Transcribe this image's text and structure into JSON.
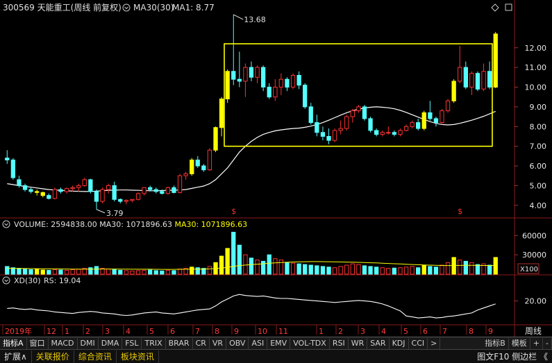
{
  "header": {
    "code": "300569",
    "name": "天能重工",
    "period": "(周线 前复权)",
    "ma_label": "MA30(30)",
    "ma_value": "MA1: 8.77"
  },
  "annotations": {
    "high": "13.68",
    "low": "3.79"
  },
  "volume_header": {
    "title": "VOLUME: 2594838.00",
    "ma_white": "MA30: 1071896.63",
    "ma_yellow": "MA30: 1071896.63",
    "unit": "X100"
  },
  "xd_header": {
    "title": "XD(30)",
    "rs": "RS: 19.04"
  },
  "period_label": "周线",
  "x_axis_labels": [
    "2019年",
    "12",
    "1",
    "2",
    "3",
    "4",
    "5",
    "6",
    "7",
    "8",
    "9",
    "10",
    "11",
    "1",
    "2",
    "3",
    "4",
    "5",
    "6",
    "7",
    "8",
    "9"
  ],
  "indicator_tabs": [
    "指标A",
    "窗口",
    "MACD",
    "DMI",
    "DMA",
    "FSL",
    "TRIX",
    "BRAR",
    "CR",
    "VR",
    "OBV",
    "ASI",
    "EMV",
    "VOL-TDX",
    "RSI",
    "WR",
    "SAR",
    "KDJ",
    "CCI",
    ">"
  ],
  "right_tabs": [
    "指标B",
    "模板",
    "+",
    "-"
  ],
  "bottom_bar": {
    "left": [
      "扩展∧",
      "关联报价",
      "综合资讯",
      "板块资讯"
    ],
    "right": "图文F10 侧边栏 《"
  },
  "markers": [
    "$",
    "$"
  ],
  "chart_data": [
    {
      "type": "candlestick",
      "title": "300569 天能重工 (周线 前复权)",
      "ylim": [
        3.5,
        14.0
      ],
      "y_ticks": [
        4.0,
        5.0,
        6.0,
        7.0,
        8.0,
        9.0,
        10.0,
        11.0,
        12.0
      ],
      "colors": {
        "up": "#ff3232",
        "down": "#54ffff",
        "ma": "#ffffff",
        "highlight": "#ffff00",
        "box": "#ffff00"
      },
      "ohlc": [
        [
          6.4,
          6.8,
          6.1,
          6.3
        ],
        [
          6.3,
          6.4,
          5.3,
          5.4
        ],
        [
          5.3,
          5.5,
          4.9,
          5.0
        ],
        [
          5.0,
          5.1,
          4.7,
          4.8
        ],
        [
          4.8,
          4.9,
          4.6,
          4.7
        ],
        [
          4.7,
          4.8,
          4.5,
          4.65
        ],
        [
          4.65,
          4.7,
          4.4,
          4.5
        ],
        [
          4.5,
          4.6,
          4.3,
          4.35
        ],
        [
          4.35,
          4.9,
          4.3,
          4.8
        ],
        [
          4.8,
          4.9,
          4.6,
          4.7
        ],
        [
          4.7,
          4.9,
          4.6,
          4.85
        ],
        [
          4.85,
          5.0,
          4.7,
          4.9
        ],
        [
          4.9,
          5.1,
          4.7,
          5.0
        ],
        [
          5.0,
          5.4,
          4.95,
          5.3
        ],
        [
          5.3,
          5.35,
          4.6,
          4.7
        ],
        [
          4.7,
          4.8,
          3.79,
          4.2
        ],
        [
          4.2,
          4.9,
          4.1,
          4.8
        ],
        [
          4.8,
          5.1,
          4.6,
          5.0
        ],
        [
          5.0,
          5.2,
          4.2,
          4.3
        ],
        [
          4.3,
          4.35,
          4.1,
          4.2
        ],
        [
          4.2,
          4.3,
          4.05,
          4.25
        ],
        [
          4.25,
          4.3,
          4.15,
          4.3
        ],
        [
          4.3,
          4.65,
          4.25,
          4.6
        ],
        [
          4.6,
          4.9,
          4.5,
          4.9
        ],
        [
          4.9,
          5.0,
          4.7,
          4.8
        ],
        [
          4.8,
          4.9,
          4.6,
          4.7
        ],
        [
          4.7,
          4.8,
          4.55,
          4.6
        ],
        [
          4.6,
          4.95,
          4.55,
          4.9
        ],
        [
          4.9,
          5.0,
          4.6,
          4.65
        ],
        [
          4.65,
          5.6,
          4.6,
          5.5
        ],
        [
          5.5,
          5.7,
          5.3,
          5.6
        ],
        [
          5.6,
          6.4,
          5.5,
          6.3
        ],
        [
          6.3,
          6.5,
          5.9,
          6.0
        ],
        [
          6.0,
          6.1,
          5.7,
          5.8
        ],
        [
          5.8,
          6.9,
          5.75,
          6.8
        ],
        [
          6.8,
          8.0,
          6.7,
          7.95
        ],
        [
          7.95,
          9.5,
          7.5,
          9.4
        ],
        [
          9.4,
          10.9,
          9.2,
          10.8
        ],
        [
          10.8,
          13.68,
          10.1,
          10.4
        ],
        [
          10.4,
          11.8,
          10.0,
          10.3
        ],
        [
          10.3,
          11.2,
          9.5,
          11.0
        ],
        [
          11.0,
          11.3,
          10.3,
          10.5
        ],
        [
          10.5,
          11.1,
          10.2,
          11.0
        ],
        [
          11.0,
          11.1,
          9.8,
          10.0
        ],
        [
          10.0,
          10.2,
          9.4,
          9.5
        ],
        [
          9.5,
          10.4,
          9.3,
          10.0
        ],
        [
          10.0,
          10.7,
          9.6,
          10.4
        ],
        [
          10.4,
          10.5,
          9.8,
          10.0
        ],
        [
          10.0,
          10.7,
          9.9,
          10.6
        ],
        [
          10.6,
          10.8,
          9.9,
          10.1
        ],
        [
          10.1,
          10.2,
          8.9,
          9.0
        ],
        [
          9.0,
          9.2,
          8.1,
          8.2
        ],
        [
          8.2,
          8.6,
          7.5,
          7.7
        ],
        [
          7.7,
          8.0,
          7.3,
          7.5
        ],
        [
          7.5,
          7.9,
          7.1,
          7.3
        ],
        [
          7.3,
          7.9,
          7.2,
          7.8
        ],
        [
          7.8,
          8.3,
          7.6,
          7.9
        ],
        [
          7.9,
          8.6,
          7.8,
          8.5
        ],
        [
          8.5,
          8.9,
          8.2,
          8.8
        ],
        [
          8.8,
          9.1,
          8.7,
          9.0
        ],
        [
          9.0,
          9.1,
          8.3,
          8.4
        ],
        [
          8.4,
          8.5,
          7.7,
          7.8
        ],
        [
          7.8,
          7.9,
          7.5,
          7.6
        ],
        [
          7.6,
          7.8,
          7.5,
          7.7
        ],
        [
          7.7,
          8.0,
          7.6,
          7.7
        ],
        [
          7.7,
          7.8,
          7.5,
          7.6
        ],
        [
          7.6,
          7.9,
          7.5,
          7.8
        ],
        [
          7.8,
          8.1,
          7.75,
          8.0
        ],
        [
          8.0,
          8.3,
          7.9,
          8.2
        ],
        [
          8.2,
          8.4,
          7.8,
          7.9
        ],
        [
          7.9,
          8.8,
          7.8,
          8.7
        ],
        [
          8.7,
          9.3,
          8.3,
          8.4
        ],
        [
          8.4,
          8.5,
          8.0,
          8.2
        ],
        [
          8.2,
          8.9,
          8.1,
          8.8
        ],
        [
          8.8,
          9.4,
          8.7,
          9.3
        ],
        [
          9.3,
          10.4,
          9.2,
          10.3
        ],
        [
          10.3,
          12.1,
          10.2,
          11.0
        ],
        [
          11.0,
          11.3,
          9.9,
          10.0
        ],
        [
          10.0,
          10.8,
          9.6,
          10.7
        ],
        [
          10.7,
          10.8,
          9.8,
          9.9
        ],
        [
          9.9,
          11.2,
          9.8,
          10.8
        ],
        [
          10.8,
          11.3,
          9.9,
          10.0
        ],
        [
          10.0,
          12.8,
          9.95,
          12.7
        ]
      ],
      "ma30": [
        5.1,
        5.05,
        5.0,
        4.96,
        4.92,
        4.88,
        4.84,
        4.8,
        4.78,
        4.76,
        4.74,
        4.72,
        4.71,
        4.7,
        4.7,
        4.72,
        4.74,
        4.76,
        4.77,
        4.78,
        4.78,
        4.77,
        4.76,
        4.75,
        4.74,
        4.74,
        4.75,
        4.76,
        4.77,
        4.78,
        4.8,
        4.86,
        4.92,
        4.98,
        5.1,
        5.3,
        5.6,
        5.9,
        6.3,
        6.7,
        7.0,
        7.25,
        7.45,
        7.6,
        7.7,
        7.78,
        7.83,
        7.87,
        7.9,
        7.92,
        7.96,
        8.02,
        8.1,
        8.2,
        8.32,
        8.45,
        8.58,
        8.7,
        8.8,
        8.88,
        8.94,
        8.98,
        9.0,
        8.98,
        8.95,
        8.9,
        8.82,
        8.72,
        8.6,
        8.48,
        8.36,
        8.25,
        8.16,
        8.1,
        8.08,
        8.1,
        8.16,
        8.24,
        8.32,
        8.42,
        8.52,
        8.64,
        8.77
      ],
      "highlight_bars": [
        5,
        6,
        31,
        35,
        36,
        37,
        70,
        75,
        82
      ],
      "box": {
        "x1_index": 37,
        "x2_index": 82,
        "y_top": 12.2,
        "y_bottom": 7.0
      }
    },
    {
      "type": "bar",
      "title": "VOLUME",
      "ylim": [
        0,
        70000
      ],
      "y_ticks": [
        30000,
        60000
      ],
      "volumes": [
        12000,
        10000,
        9000,
        8000,
        7000,
        7500,
        6500,
        6000,
        7000,
        6500,
        6000,
        7000,
        7500,
        9000,
        10000,
        12000,
        9000,
        8000,
        7500,
        6000,
        5500,
        5000,
        5500,
        6000,
        6500,
        5500,
        5000,
        6000,
        5500,
        8000,
        9000,
        11000,
        10000,
        9000,
        12000,
        18000,
        28000,
        40000,
        65000,
        45000,
        30000,
        25000,
        22000,
        20000,
        30000,
        24000,
        22000,
        18000,
        17000,
        16000,
        15000,
        14000,
        13000,
        12000,
        11000,
        10000,
        12000,
        14000,
        16000,
        15000,
        13000,
        12000,
        11000,
        10000,
        9000,
        9500,
        10000,
        11000,
        12000,
        10000,
        14000,
        12000,
        11000,
        14000,
        18000,
        26000,
        22000,
        20000,
        18000,
        15000,
        16000,
        14000,
        25948
      ],
      "ma30_line": [
        9000,
        8900,
        8800,
        8700,
        8600,
        8500,
        8400,
        8300,
        8200,
        8100,
        8000,
        7900,
        7800,
        7800,
        7800,
        7900,
        8000,
        8000,
        8000,
        7900,
        7800,
        7700,
        7600,
        7600,
        7600,
        7500,
        7400,
        7400,
        7400,
        7500,
        7600,
        7700,
        7800,
        7900,
        8200,
        8700,
        9400,
        10400,
        12200,
        13300,
        14100,
        14800,
        15500,
        16100,
        17000,
        17600,
        18100,
        18500,
        18800,
        19100,
        19300,
        19500,
        19500,
        19400,
        19300,
        19100,
        18900,
        18700,
        18500,
        18300,
        18000,
        17700,
        17400,
        17000,
        16600,
        16200,
        15800,
        15400,
        15000,
        14600,
        14300,
        14000,
        13700,
        13500,
        13400,
        13500,
        13600,
        13700,
        13700,
        13600,
        13500,
        13400,
        13500
      ]
    },
    {
      "type": "line",
      "title": "XD(30)",
      "ylim": [
        -25,
        50
      ],
      "y_ticks": [
        20.0
      ],
      "values": [
        5,
        6,
        4,
        3,
        4,
        2,
        1,
        0,
        -2,
        -3,
        -4,
        -5,
        -3,
        -2,
        -1,
        -2,
        -4,
        -5,
        -6,
        -8,
        -9,
        -8,
        -6,
        -4,
        -3,
        -2,
        -4,
        -5,
        -6,
        -4,
        -2,
        0,
        2,
        3,
        4,
        10,
        18,
        24,
        30,
        33,
        31,
        30,
        29,
        30,
        28,
        26,
        25,
        25,
        24,
        23,
        22,
        21,
        20,
        19,
        18,
        17,
        18,
        19,
        20,
        21,
        20,
        19,
        17,
        14,
        10,
        5,
        0,
        -10,
        -12,
        -14,
        -13,
        -12,
        -14,
        -13,
        -11,
        -10,
        -8,
        -6,
        -4,
        2,
        6,
        10,
        14
      ]
    }
  ]
}
